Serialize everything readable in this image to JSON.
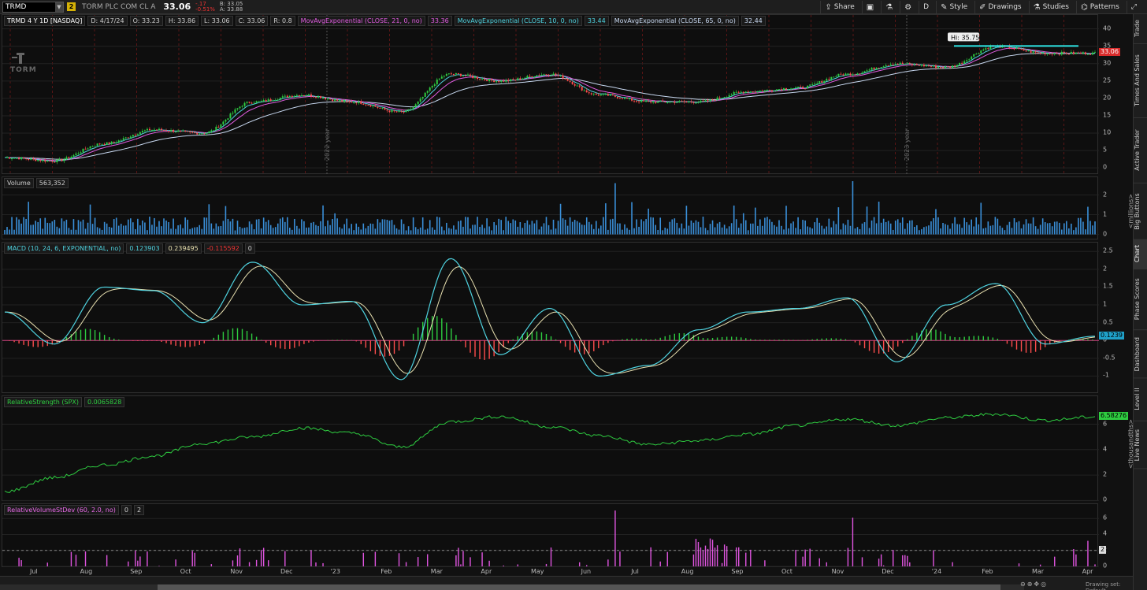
{
  "toolbar": {
    "symbol": "TRMD",
    "link_badge": "2",
    "company": "TORM PLC COM CL A",
    "last": "33.06",
    "change": "-.17",
    "change_pct": "-0.51%",
    "bid": "B: 33.05",
    "ask": "A: 33.88",
    "buttons": [
      {
        "label": "Share",
        "icon": "share-icon"
      },
      {
        "label": "",
        "icon": "save-chart-icon"
      },
      {
        "label": "",
        "icon": "flask-icon"
      },
      {
        "label": "",
        "icon": "gear-icon"
      },
      {
        "label": "D",
        "icon": ""
      },
      {
        "label": "Style",
        "icon": "style-icon"
      },
      {
        "label": "Drawings",
        "icon": "pencil-icon"
      },
      {
        "label": "Studies",
        "icon": "studies-icon"
      },
      {
        "label": "Patterns",
        "icon": "patterns-icon"
      }
    ]
  },
  "price_pane": {
    "header": [
      "TRMD 4 Y 1D [NASDAQ]",
      "D: 4/17/24",
      "O: 33.23",
      "H: 33.86",
      "L: 33.06",
      "C: 33.06",
      "R: 0.8"
    ],
    "studies": [
      {
        "name": "MovAvgExponential (CLOSE, 21, 0, no)",
        "value": "33.36",
        "color": "#e05ce0"
      },
      {
        "name": "MovAvgExponential (CLOSE, 10, 0, no)",
        "value": "33.44",
        "color": "#4fd3e0"
      },
      {
        "name": "MovAvgExponential (CLOSE, 65, 0, no)",
        "value": "32.44",
        "color": "#c8d8f0"
      }
    ],
    "hi_label": "Hi: 35.75",
    "last_tag": "33.06",
    "logo": "TORM",
    "year_labels": [
      "2022 year",
      "2023 year"
    ],
    "axis_ticks": [
      "40",
      "35",
      "30",
      "25",
      "20",
      "15",
      "10",
      "5",
      "0"
    ]
  },
  "volume_pane": {
    "label": "Volume",
    "value": "563,352",
    "axis_ticks": [
      "2",
      "1",
      "0"
    ],
    "unit": "<millions>"
  },
  "macd_pane": {
    "label": "MACD (10, 24, 6, EXPONENTIAL, no)",
    "values": [
      "0.123903",
      "0.239495",
      "-0.115592",
      "0"
    ],
    "value_colors": [
      "#4fd3e0",
      "#e8e0b0",
      "#e33",
      "#ccc"
    ],
    "axis_ticks": [
      "2.5",
      "2",
      "1.5",
      "1",
      "0.5",
      "0",
      "-0.5",
      "-1"
    ],
    "last_tag": "0.1239"
  },
  "rs_pane": {
    "label": "RelativeStrength (SPX)",
    "value": "0.0065828",
    "axis_ticks": [
      "6",
      "4",
      "2",
      "0"
    ],
    "unit": "<thousandths>",
    "last_tag": "6.58276"
  },
  "rvsd_pane": {
    "label": "RelativeVolumeStDev (60, 2.0, no)",
    "values": [
      "0",
      "2"
    ],
    "axis_ticks": [
      "6",
      "4",
      "2",
      "0"
    ],
    "level_tag": "2"
  },
  "time_axis": {
    "months": [
      "Jul",
      "Aug",
      "Sep",
      "Oct",
      "Nov",
      "Dec",
      "'23",
      "Feb",
      "Mar",
      "Apr",
      "May",
      "Jun",
      "Jul",
      "Aug",
      "Sep",
      "Oct",
      "Nov",
      "Dec",
      "'24",
      "Feb",
      "Mar",
      "Apr"
    ],
    "drawing_set": "Drawing set: Default"
  },
  "right_tabs": [
    "Trade",
    "Times And Sales",
    "Active Trader",
    "Big Buttons",
    "Chart",
    "Phase Scores",
    "Dashboard",
    "Level II",
    "Live News"
  ],
  "colors": {
    "up": "#2ecc40",
    "down": "#ff4d4d",
    "hi_line": "#2ee6e6",
    "macd_line": "#4fd3e0",
    "macd_signal": "#e8e0b0",
    "rs_line": "#2ecc40",
    "rvsd_bar": "#e055e0",
    "volume": "#3a8fd8"
  },
  "chart_data": [
    {
      "type": "line",
      "name": "TRMD daily price",
      "x": [
        "2022-06",
        "2022-07",
        "2022-08",
        "2022-09",
        "2022-10",
        "2022-11",
        "2022-12",
        "2023-01",
        "2023-02",
        "2023-03",
        "2023-04",
        "2023-05",
        "2023-06",
        "2023-07",
        "2023-08",
        "2023-09",
        "2023-10",
        "2023-11",
        "2023-12",
        "2024-01",
        "2024-02",
        "2024-03",
        "2024-04"
      ],
      "values": [
        3,
        2,
        7,
        11,
        10,
        19,
        21,
        19,
        16,
        27,
        25,
        27,
        21,
        19,
        19,
        22,
        23,
        27,
        30,
        29,
        35,
        33,
        33
      ],
      "ylim": [
        0,
        42
      ]
    },
    {
      "type": "line",
      "name": "MACD",
      "x": [
        "2022-06",
        "2022-07",
        "2022-08",
        "2022-09",
        "2022-10",
        "2022-11",
        "2022-12",
        "2023-01",
        "2023-02",
        "2023-03",
        "2023-04",
        "2023-05",
        "2023-06",
        "2023-07",
        "2023-08",
        "2023-09",
        "2023-10",
        "2023-11",
        "2023-12",
        "2024-01",
        "2024-02",
        "2024-03",
        "2024-04"
      ],
      "values": [
        0.8,
        -0.1,
        1.5,
        1.4,
        0.5,
        2.2,
        1.0,
        1.1,
        -1.1,
        2.3,
        -0.4,
        0.9,
        -1.0,
        -0.7,
        0.3,
        0.8,
        0.9,
        1.2,
        -0.6,
        1.0,
        1.6,
        -0.1,
        0.12
      ],
      "ylim": [
        -1.3,
        2.6
      ]
    },
    {
      "type": "line",
      "name": "RelativeStrength (SPX)",
      "x": [
        "2022-06",
        "2022-07",
        "2022-08",
        "2022-09",
        "2022-10",
        "2022-11",
        "2022-12",
        "2023-01",
        "2023-02",
        "2023-03",
        "2023-04",
        "2023-05",
        "2023-06",
        "2023-07",
        "2023-08",
        "2023-09",
        "2023-10",
        "2023-11",
        "2023-12",
        "2024-01",
        "2024-02",
        "2024-03",
        "2024-04"
      ],
      "values": [
        0.7,
        1.8,
        2.8,
        3.5,
        4.5,
        5.0,
        5.7,
        5.3,
        4.2,
        6.2,
        6.6,
        5.8,
        5.1,
        4.4,
        4.7,
        5.2,
        5.9,
        6.4,
        5.9,
        6.5,
        6.8,
        6.3,
        6.58
      ],
      "ylim": [
        0,
        7.5
      ]
    }
  ]
}
